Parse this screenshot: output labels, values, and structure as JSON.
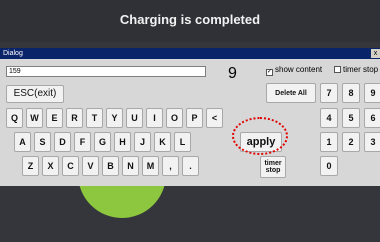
{
  "banner": {
    "title": "Charging is completed"
  },
  "dialog": {
    "title": "Dialog",
    "close_label": "x",
    "input_value": "159",
    "digit_display": "9",
    "show_content": {
      "label": "show content",
      "checked": true
    },
    "timer_stop": {
      "label": "timer stop",
      "checked": false
    },
    "esc_label": "ESC(exit)",
    "delete_all_label": "Delete All",
    "apply_label": "apply",
    "timer_stop_key_label": "timer stop"
  },
  "keyboard": {
    "row1": [
      "Q",
      "W",
      "E",
      "R",
      "T",
      "Y",
      "U",
      "I",
      "O",
      "P",
      "<"
    ],
    "row2": [
      "A",
      "S",
      "D",
      "F",
      "G",
      "H",
      "J",
      "K",
      "L"
    ],
    "row3": [
      "Z",
      "X",
      "C",
      "V",
      "B",
      "N",
      "M",
      ",",
      "."
    ]
  },
  "numpad": {
    "row1": [
      "7",
      "8",
      "9"
    ],
    "row2": [
      "4",
      "5",
      "6"
    ],
    "row3": [
      "1",
      "2",
      "3"
    ],
    "row4": [
      "0"
    ]
  },
  "colors": {
    "banner_bg": "#2f3136",
    "dialog_bg": "#d7d7d7",
    "titlebar_bg": "#0a246a",
    "highlight": "#e00000",
    "accent_green": "#8dc63f"
  }
}
